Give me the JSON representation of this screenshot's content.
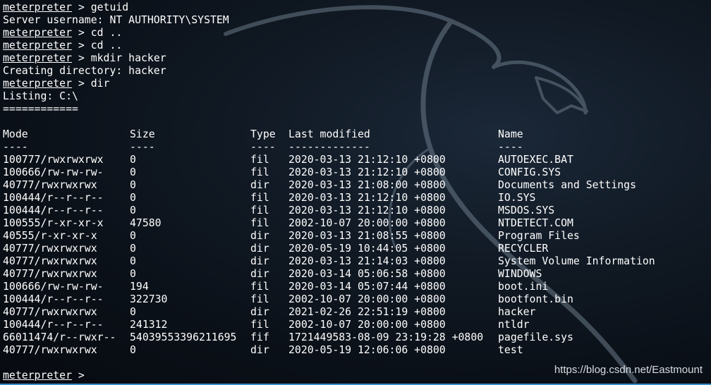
{
  "prompt": "meterpreter",
  "prompt_sep": " > ",
  "history": [
    {
      "kind": "cmd",
      "text": "getuid"
    },
    {
      "kind": "out",
      "text": "Server username: NT AUTHORITY\\SYSTEM"
    },
    {
      "kind": "cmd",
      "text": "cd .."
    },
    {
      "kind": "cmd",
      "text": "cd .."
    },
    {
      "kind": "cmd",
      "text": "mkdir hacker"
    },
    {
      "kind": "out",
      "text": "Creating directory: hacker"
    },
    {
      "kind": "cmd",
      "text": "dir"
    },
    {
      "kind": "out",
      "text": "Listing: C:\\"
    },
    {
      "kind": "out",
      "text": "============"
    }
  ],
  "listing": {
    "headers": {
      "mode": "Mode",
      "size": "Size",
      "type": "Type",
      "modified": "Last modified",
      "name": "Name"
    },
    "underline": {
      "mode": "----",
      "size": "----",
      "type": "----",
      "modified": "-------------",
      "name": "----"
    },
    "rows": [
      {
        "mode": "100777/rwxrwxrwx",
        "size": "0",
        "type": "fil",
        "modified": "2020-03-13 21:12:10 +0800",
        "name": "AUTOEXEC.BAT"
      },
      {
        "mode": "100666/rw-rw-rw-",
        "size": "0",
        "type": "fil",
        "modified": "2020-03-13 21:12:10 +0800",
        "name": "CONFIG.SYS"
      },
      {
        "mode": "40777/rwxrwxrwx",
        "size": "0",
        "type": "dir",
        "modified": "2020-03-13 21:08:00 +0800",
        "name": "Documents and Settings"
      },
      {
        "mode": "100444/r--r--r--",
        "size": "0",
        "type": "fil",
        "modified": "2020-03-13 21:12:10 +0800",
        "name": "IO.SYS"
      },
      {
        "mode": "100444/r--r--r--",
        "size": "0",
        "type": "fil",
        "modified": "2020-03-13 21:12:10 +0800",
        "name": "MSDOS.SYS"
      },
      {
        "mode": "100555/r-xr-xr-x",
        "size": "47580",
        "type": "fil",
        "modified": "2002-10-07 20:00:00 +0800",
        "name": "NTDETECT.COM"
      },
      {
        "mode": "40555/r-xr-xr-x",
        "size": "0",
        "type": "dir",
        "modified": "2020-03-13 21:08:55 +0800",
        "name": "Program Files"
      },
      {
        "mode": "40777/rwxrwxrwx",
        "size": "0",
        "type": "dir",
        "modified": "2020-05-19 10:44:05 +0800",
        "name": "RECYCLER"
      },
      {
        "mode": "40777/rwxrwxrwx",
        "size": "0",
        "type": "dir",
        "modified": "2020-03-13 21:14:03 +0800",
        "name": "System Volume Information"
      },
      {
        "mode": "40777/rwxrwxrwx",
        "size": "0",
        "type": "dir",
        "modified": "2020-03-14 05:06:58 +0800",
        "name": "WINDOWS"
      },
      {
        "mode": "100666/rw-rw-rw-",
        "size": "194",
        "type": "fil",
        "modified": "2020-03-14 05:07:44 +0800",
        "name": "boot.ini"
      },
      {
        "mode": "100444/r--r--r--",
        "size": "322730",
        "type": "fil",
        "modified": "2002-10-07 20:00:00 +0800",
        "name": "bootfont.bin"
      },
      {
        "mode": "40777/rwxrwxrwx",
        "size": "0",
        "type": "dir",
        "modified": "2021-02-26 22:51:19 +0800",
        "name": "hacker"
      },
      {
        "mode": "100444/r--r--r--",
        "size": "241312",
        "type": "fil",
        "modified": "2002-10-07 20:00:00 +0800",
        "name": "ntldr"
      },
      {
        "mode": "66011474/r--rwxr--",
        "size": "54039553396211695",
        "type": "fif",
        "modified": "1721449583-08-09 23:19:28 +0800",
        "name": "pagefile.sys"
      },
      {
        "mode": "40777/rwxrwxrwx",
        "size": "0",
        "type": "dir",
        "modified": "2020-05-19 12:06:06 +0800",
        "name": "test"
      }
    ]
  },
  "current_input": "",
  "watermark": "https://blog.csdn.net/Eastmount",
  "colors": {
    "background": "#0b1119",
    "text": "#ffffff",
    "dragon": "#6b7a89",
    "accent_bar": "#3a8ec9"
  },
  "icons": {
    "background_logo": "kali-dragon-icon"
  }
}
